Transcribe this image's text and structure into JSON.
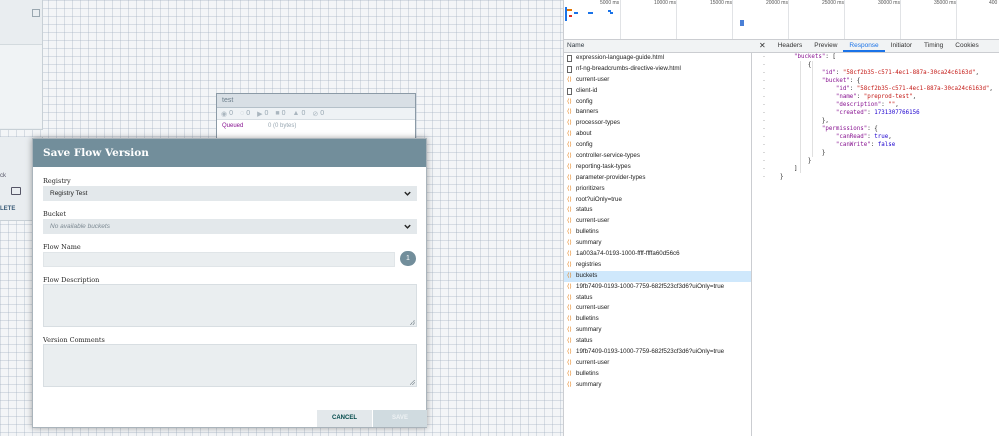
{
  "canvas": {
    "left_panel2": {
      "label": "ck",
      "delete_label": "LETE"
    },
    "process_group": {
      "title": "test",
      "stats": [
        "0",
        "0",
        "0",
        "0",
        "0",
        "0"
      ],
      "queued_label": "Queued",
      "queued_value": "0 (0 bytes)"
    }
  },
  "dialog": {
    "title": "Save Flow Version",
    "registry_label": "Registry",
    "registry_value": "Registry Test",
    "bucket_label": "Bucket",
    "bucket_placeholder": "No available buckets",
    "flow_name_label": "Flow Name",
    "flow_name_badge": "1",
    "flow_description_label": "Flow Description",
    "version_comments_label": "Version Comments",
    "cancel_label": "CANCEL",
    "save_label": "SAVE"
  },
  "devtools": {
    "timeline_ticks": [
      "5000 ms",
      "10000 ms",
      "15000 ms",
      "20000 ms",
      "25000 ms",
      "30000 ms",
      "35000 ms",
      "400"
    ],
    "name_header": "Name",
    "requests": [
      {
        "name": "expression-language-guide.html",
        "type": "doc"
      },
      {
        "name": "nf-ng-breadcrumbs-directive-view.html",
        "type": "doc"
      },
      {
        "name": "current-user",
        "type": "xhr"
      },
      {
        "name": "client-id",
        "type": "doc"
      },
      {
        "name": "config",
        "type": "xhr"
      },
      {
        "name": "banners",
        "type": "xhr"
      },
      {
        "name": "processor-types",
        "type": "xhr"
      },
      {
        "name": "about",
        "type": "xhr"
      },
      {
        "name": "config",
        "type": "xhr"
      },
      {
        "name": "controller-service-types",
        "type": "xhr"
      },
      {
        "name": "reporting-task-types",
        "type": "xhr"
      },
      {
        "name": "parameter-provider-types",
        "type": "xhr"
      },
      {
        "name": "prioritizers",
        "type": "xhr"
      },
      {
        "name": "root?uiOnly=true",
        "type": "xhr"
      },
      {
        "name": "status",
        "type": "xhr"
      },
      {
        "name": "current-user",
        "type": "xhr"
      },
      {
        "name": "bulletins",
        "type": "xhr"
      },
      {
        "name": "summary",
        "type": "xhr"
      },
      {
        "name": "1a003a74-0193-1000-ffff-ffffa60d56c6",
        "type": "xhr"
      },
      {
        "name": "registries",
        "type": "xhr"
      },
      {
        "name": "buckets",
        "type": "xhr",
        "selected": true
      },
      {
        "name": "19fb7409-0193-1000-7759-682f523cf3d6?uiOnly=true",
        "type": "xhr"
      },
      {
        "name": "status",
        "type": "xhr"
      },
      {
        "name": "current-user",
        "type": "xhr"
      },
      {
        "name": "bulletins",
        "type": "xhr"
      },
      {
        "name": "summary",
        "type": "xhr"
      },
      {
        "name": "status",
        "type": "xhr"
      },
      {
        "name": "19fb7409-0193-1000-7759-682f523cf3d6?uiOnly=true",
        "type": "xhr"
      },
      {
        "name": "current-user",
        "type": "xhr"
      },
      {
        "name": "bulletins",
        "type": "xhr"
      },
      {
        "name": "summary",
        "type": "xhr"
      }
    ],
    "tabs": [
      "Headers",
      "Preview",
      "Response",
      "Initiator",
      "Timing",
      "Cookies"
    ],
    "active_tab": "Response",
    "close_glyph": "✕",
    "response": {
      "buckets_key": "\"buckets\"",
      "id_key": "\"id\"",
      "id_value": "\"58cf2b35-c571-4ec1-887a-30ca24c6163d\"",
      "bucket_key": "\"bucket\"",
      "name_key": "\"name\"",
      "name_value": "\"preprod-test\"",
      "description_key": "\"description\"",
      "description_value": "\"\"",
      "created_key": "\"created\"",
      "created_value": "1731307766156",
      "permissions_key": "\"permissions\"",
      "canRead_key": "\"canRead\"",
      "canRead_value": "true",
      "canWrite_key": "\"canWrite\"",
      "canWrite_value": "false",
      "gutter": "-"
    }
  }
}
